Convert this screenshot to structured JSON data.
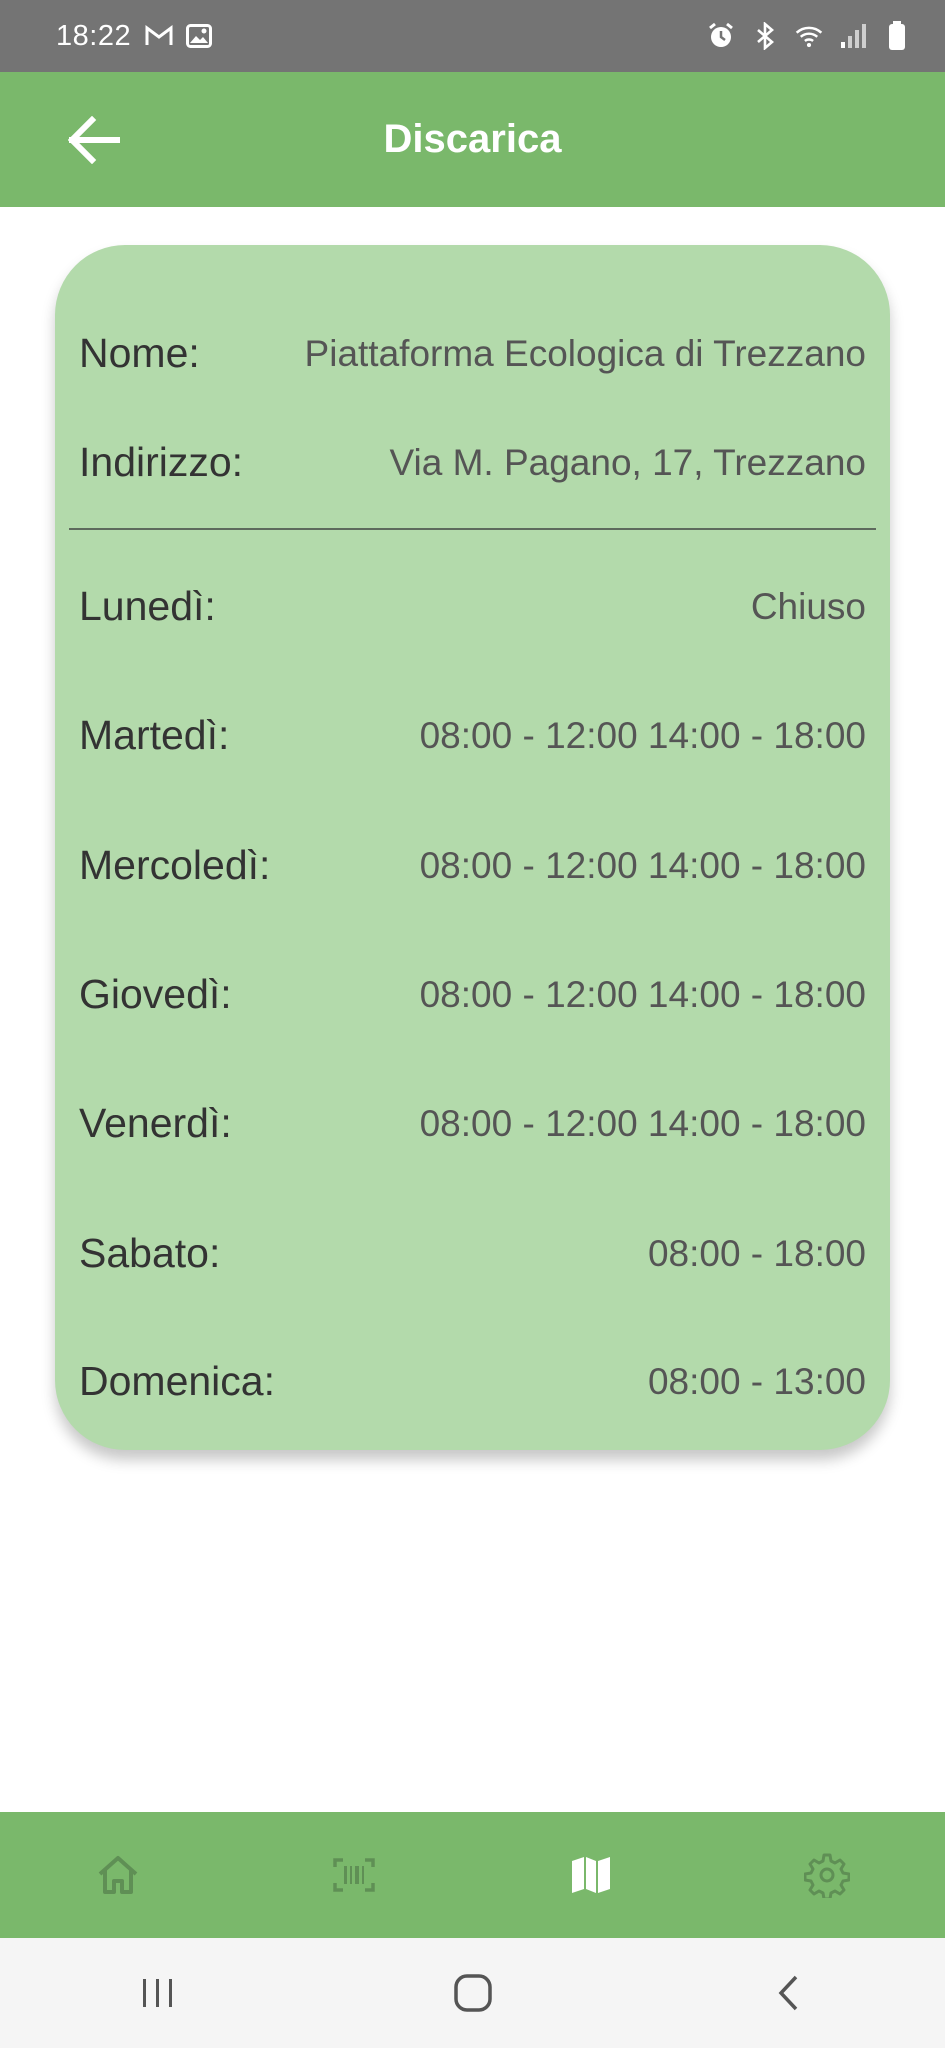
{
  "status_bar": {
    "time": "18:22",
    "left_icons": [
      "gmail-icon",
      "image-icon"
    ],
    "right_icons": [
      "alarm-icon",
      "bluetooth-icon",
      "wifi-icon",
      "signal-icon",
      "battery-icon"
    ]
  },
  "app_bar": {
    "title": "Discarica",
    "back_icon": "arrow-left-icon"
  },
  "info": {
    "name_label": "Nome:",
    "name_value": "Piattaforma Ecologica di Trezzano",
    "address_label": "Indirizzo:",
    "address_value": "Via M. Pagano, 17, Trezzano"
  },
  "schedule": [
    {
      "day": "Lunedì:",
      "hours": "Chiuso"
    },
    {
      "day": "Martedì:",
      "hours": "08:00 - 12:00 14:00 - 18:00"
    },
    {
      "day": "Mercoledì:",
      "hours": "08:00 - 12:00 14:00 - 18:00"
    },
    {
      "day": "Giovedì:",
      "hours": "08:00 - 12:00 14:00 - 18:00"
    },
    {
      "day": "Venerdì:",
      "hours": "08:00 - 12:00 14:00 - 18:00"
    },
    {
      "day": "Sabato:",
      "hours": "08:00 - 18:00"
    },
    {
      "day": "Domenica:",
      "hours": "08:00 - 13:00"
    }
  ],
  "bottom_nav": {
    "items": [
      "home-icon",
      "barcode-scan-icon",
      "map-icon",
      "settings-gear-icon"
    ],
    "active": "map-icon"
  },
  "system_nav": [
    "recent-apps-icon",
    "home-button-icon",
    "back-chevron-icon"
  ],
  "colors": {
    "app_bar": "#7ab86b",
    "card": "#b3daab",
    "status_bar": "#747474",
    "nav_inactive": "#5f8f55",
    "nav_active": "#ffffff"
  }
}
